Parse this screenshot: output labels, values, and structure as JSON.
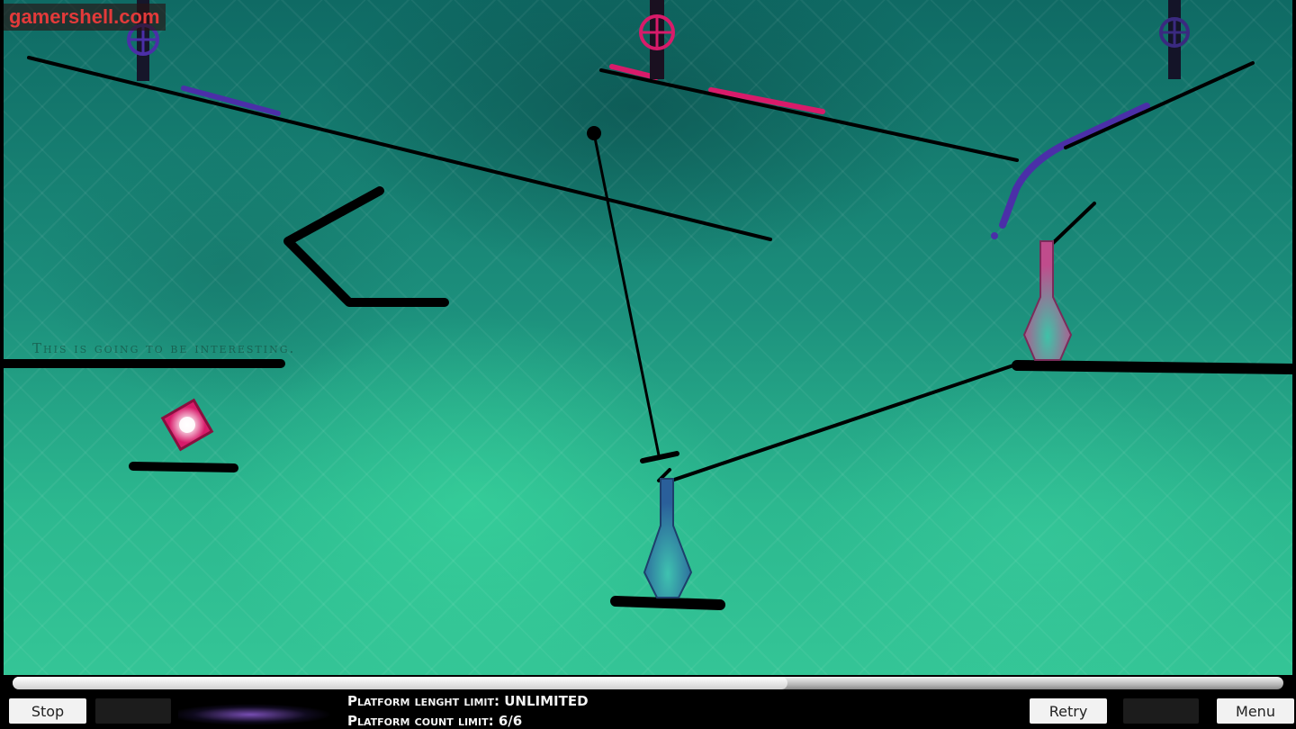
{
  "brand": {
    "logo_text": "gamershell.com"
  },
  "level": {
    "hint_text": "This is going to be interesting."
  },
  "toolbar": {
    "stop_label": "Stop",
    "retry_label": "Retry",
    "menu_label": "Menu"
  },
  "info": {
    "length_limit": "Platform lenght limit: UNLIMITED",
    "count_limit": "Platform count limit: 6/6"
  },
  "progress": {
    "fraction": 0.61
  },
  "colors": {
    "background_accent": "#2cb88f",
    "pink_liquid": "#d81b6a",
    "purple_liquid": "#4b2fa8",
    "platform": "#000000",
    "vase_blue": "#2f7fb0",
    "vase_pink": "#c8508f"
  },
  "icons": {
    "valves": [
      "valve-purple-icon",
      "valve-pink-icon",
      "valve-dark-purple-icon"
    ],
    "gem": "pink-gem-icon"
  }
}
